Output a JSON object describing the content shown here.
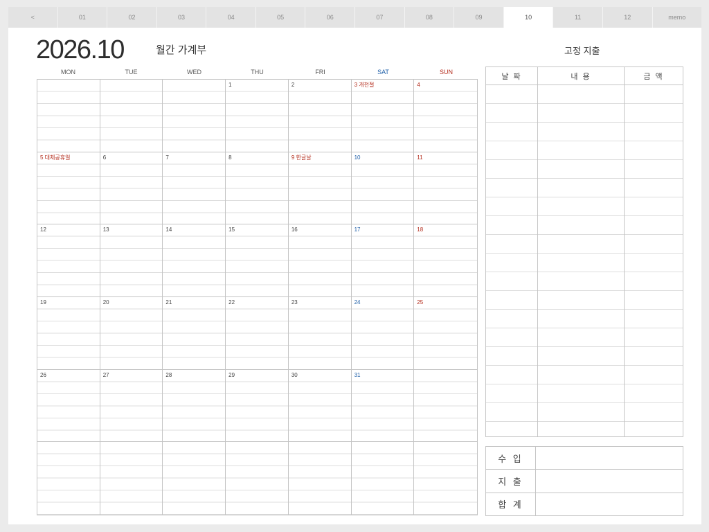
{
  "tabs": [
    "<",
    "01",
    "02",
    "03",
    "04",
    "05",
    "06",
    "07",
    "08",
    "09",
    "10",
    "11",
    "12",
    "memo"
  ],
  "active_tab": "10",
  "header": {
    "year_month": "2026.10",
    "subtitle": "월간 가계부",
    "fixed_expense_title": "고정 지출"
  },
  "weekdays": [
    "MON",
    "TUE",
    "WED",
    "THU",
    "FRI",
    "SAT",
    "SUN"
  ],
  "calendar": [
    [
      "",
      "",
      "",
      "1",
      "2",
      "3 개천절",
      "4"
    ],
    [
      "5 대체공휴일",
      "6",
      "7",
      "8",
      "9 한글날",
      "10",
      "11"
    ],
    [
      "12",
      "13",
      "14",
      "15",
      "16",
      "17",
      "18"
    ],
    [
      "19",
      "20",
      "21",
      "22",
      "23",
      "24",
      "25"
    ],
    [
      "26",
      "27",
      "28",
      "29",
      "30",
      "31",
      ""
    ],
    [
      "",
      "",
      "",
      "",
      "",
      "",
      ""
    ]
  ],
  "holiday_cells": [
    "3 개천절",
    "5 대체공휴일",
    "9 한글날"
  ],
  "fixed_table": {
    "headers": [
      "날 짜",
      "내 용",
      "금 액"
    ]
  },
  "summary": {
    "rows": [
      "수 입",
      "지 출",
      "합 계"
    ]
  },
  "colors": {
    "saturday": "#1f5fa8",
    "sunday_holiday": "#b32a1a",
    "grid": "#c4c4c4",
    "background": "#ebebeb"
  }
}
